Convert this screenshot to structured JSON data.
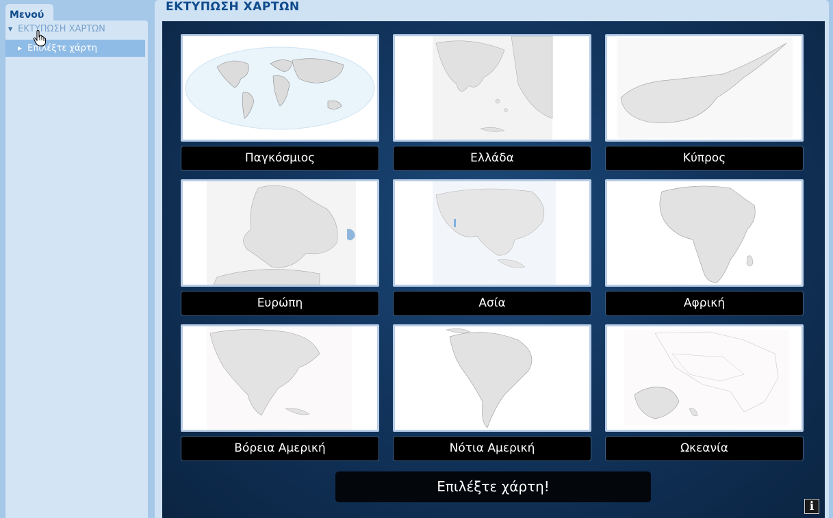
{
  "sidebar": {
    "tab_label": "Μενού",
    "root_label": "ΕΚΤΥΠΩΣΗ ΧΑΡΤΩΝ",
    "child_label": "Επιλέξτε χάρτη"
  },
  "main": {
    "title": "ΕΚΤΥΠΩΣΗ ΧΑΡΤΩΝ",
    "maps": [
      {
        "label": "Παγκόσμιος"
      },
      {
        "label": "Ελλάδα"
      },
      {
        "label": "Κύπρος"
      },
      {
        "label": "Ευρώπη"
      },
      {
        "label": "Ασία"
      },
      {
        "label": "Αφρική"
      },
      {
        "label": "Βόρεια Αμερική"
      },
      {
        "label": "Νότια Αμερική"
      },
      {
        "label": "Ωκεανία"
      }
    ],
    "select_button": "Επιλέξτε χάρτη!",
    "info_glyph": "i"
  },
  "colors": {
    "accent": "#0f4b8c",
    "sidebar_bg": "#d3e4f5",
    "selected_item": "#8fbce6",
    "stage_bg": "#12355e"
  }
}
